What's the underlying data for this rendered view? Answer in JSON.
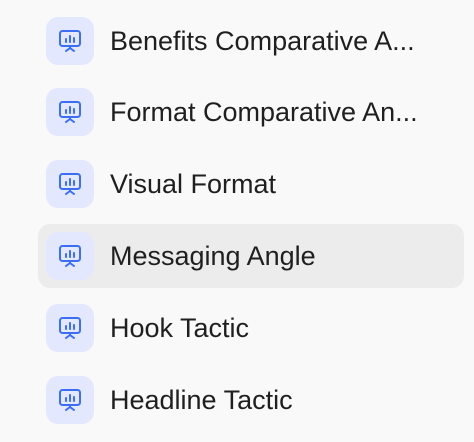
{
  "accent_color": "#3d6ff2",
  "icon_bg_color": "#e4e8ff",
  "selected_bg_color": "#ececec",
  "items": [
    {
      "label": "Benefits Comparative A...",
      "icon": "presentation-chart-icon",
      "selected": false
    },
    {
      "label": "Format Comparative An...",
      "icon": "presentation-chart-icon",
      "selected": false
    },
    {
      "label": "Visual Format",
      "icon": "presentation-chart-icon",
      "selected": false
    },
    {
      "label": "Messaging Angle",
      "icon": "presentation-chart-icon",
      "selected": true
    },
    {
      "label": "Hook Tactic",
      "icon": "presentation-chart-icon",
      "selected": false
    },
    {
      "label": "Headline Tactic",
      "icon": "presentation-chart-icon",
      "selected": false
    }
  ]
}
